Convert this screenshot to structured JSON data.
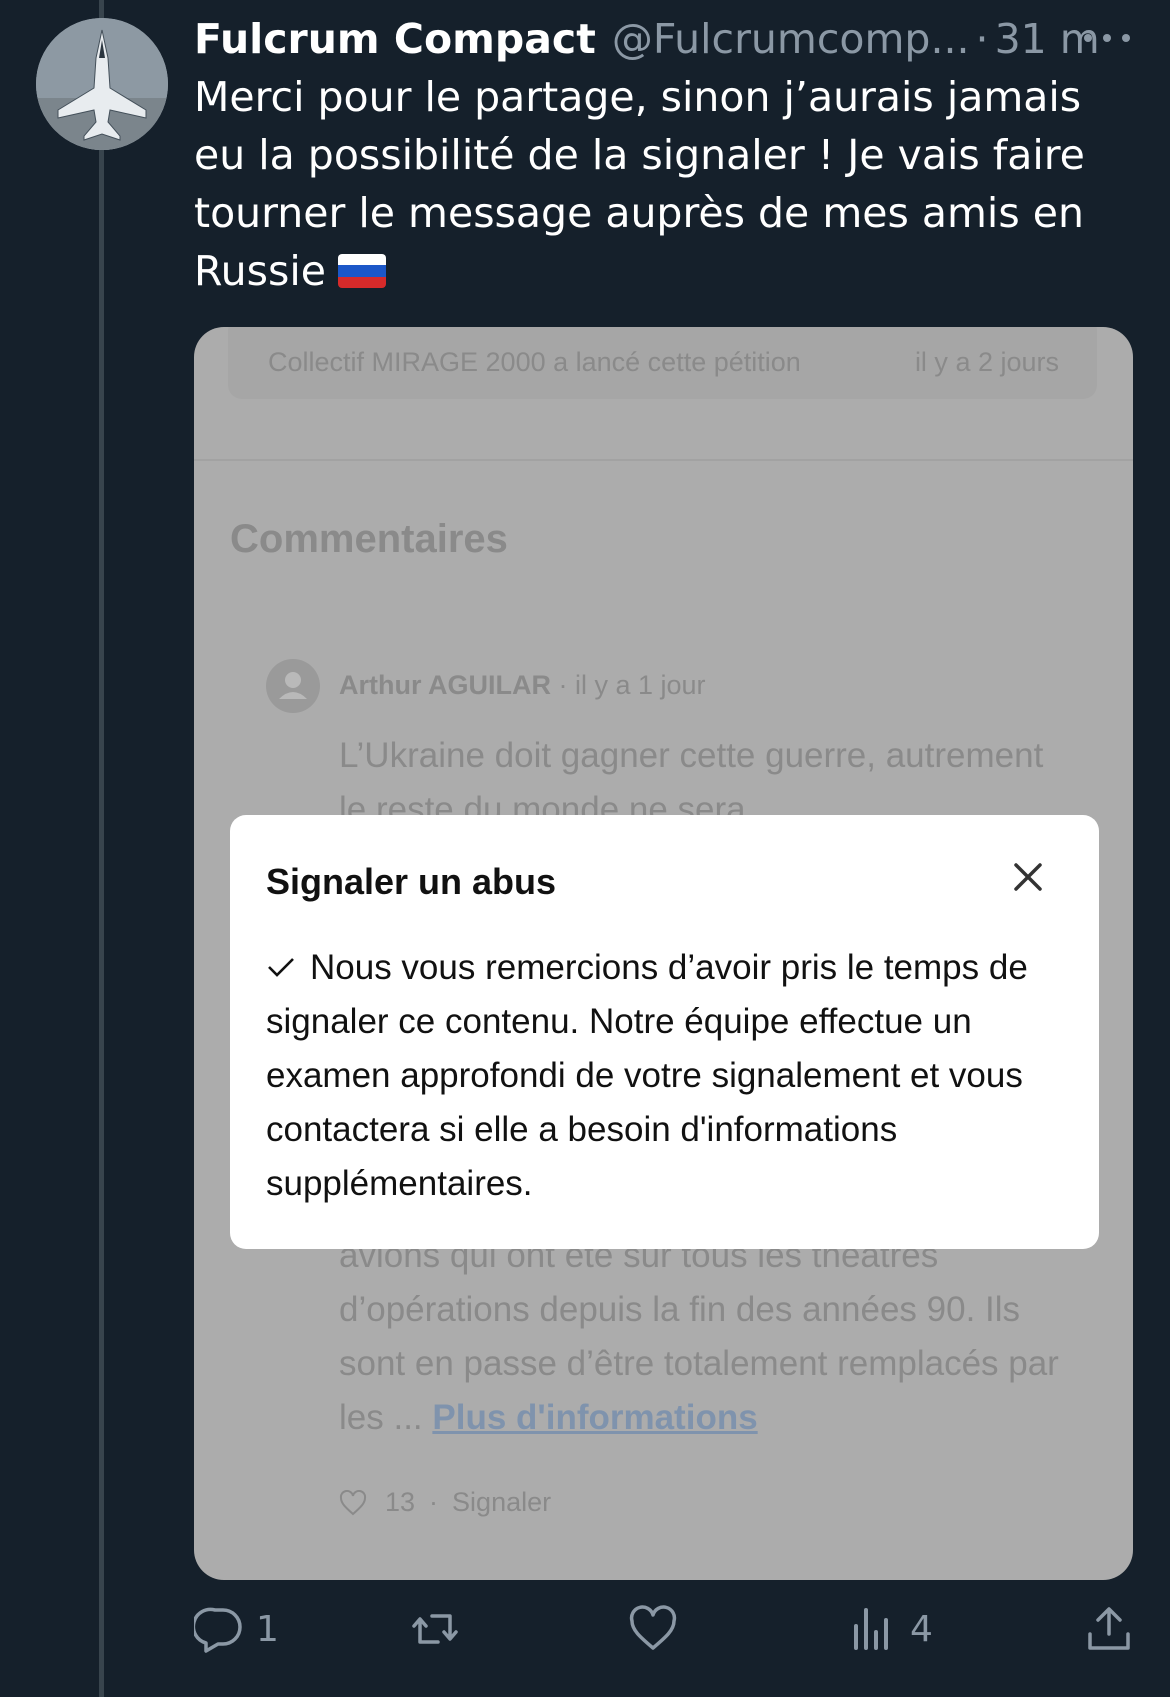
{
  "tweet": {
    "author_name": "Fulcrum Compact",
    "author_handle": "@Fulcrumcomp...",
    "separator": "·",
    "time": "31 m",
    "text": "Merci pour le partage, sinon j’aurais jamais eu la possibilité de la signaler ! Je vais faire tourner le message auprès de mes amis en Russie",
    "flag": "russia-flag"
  },
  "media": {
    "petition_text": "Collectif MIRAGE 2000 a lancé cette pétition",
    "petition_date": "il y a 2 jours",
    "comments_title": "Commentaires",
    "comment": {
      "author": "Arthur AGUILAR",
      "meta_sep": " · ",
      "time": "il y a 1 jour",
      "body_top": "L’Ukraine doit gagner cette guerre, autrement le reste du monde ne sera",
      "body_bottom": "avions qui ont été sur tous les théâtres d’opérations depuis la fin des années 90. Ils sont en passe d’être totalement remplacés par les ... ",
      "more_link": "Plus d'informations",
      "likes": "13",
      "actions_sep": "·",
      "report": "Signaler"
    },
    "modal": {
      "title": "Signaler un abus",
      "body": "Nous vous remercions d’avoir pris le temps de signaler ce contenu. Notre équipe effectue un examen approfondi de votre signalement et vous contactera si elle a besoin d'informations supplémentaires."
    }
  },
  "actions": {
    "reply_count": "1",
    "retweet_count": "",
    "like_count": "",
    "views_count": "4"
  },
  "colors": {
    "background": "#15202b",
    "secondary_text": "#8b98a5",
    "thread_line": "#38444d"
  }
}
